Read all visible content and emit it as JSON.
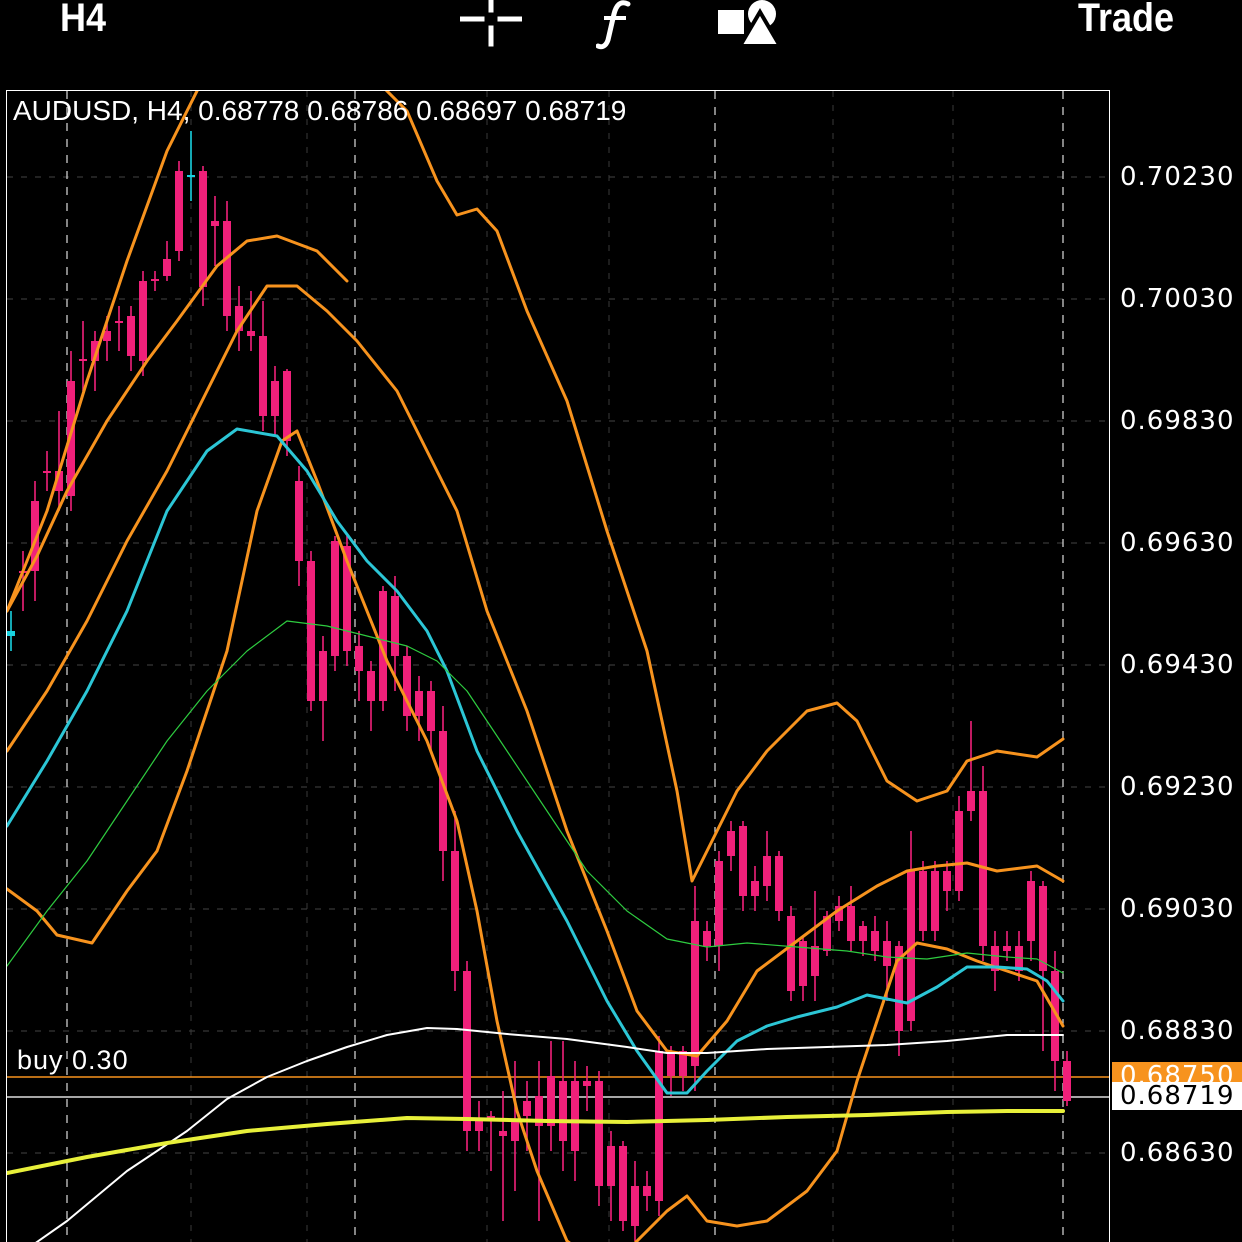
{
  "toolbar": {
    "timeframe": "H4",
    "trade_label": "Trade",
    "icons": [
      "crosshair-icon",
      "function-icon",
      "objects-icon"
    ]
  },
  "chart": {
    "symbol_info": "AUDUSD, H4, 0.68778 0.68786 0.68697 0.68719",
    "order_label": "buy 0.30",
    "price_axis": [
      "0.70230",
      "0.70030",
      "0.69830",
      "0.69630",
      "0.69430",
      "0.69230",
      "0.69030",
      "0.68830",
      "0.68630"
    ],
    "order_price": "0.68750",
    "current_price": "0.68719",
    "colors": {
      "bull": "#19d3e0",
      "bear": "#f0207a",
      "bollinger": "#f7931e",
      "ma_fast": "#2cc6d6",
      "ma_mid": "#2ecc40",
      "ma_slow": "#ffffff",
      "ma_long": "#e8f03a",
      "order_tag": "#f7931e",
      "price_tag": "#ffffff"
    }
  }
}
